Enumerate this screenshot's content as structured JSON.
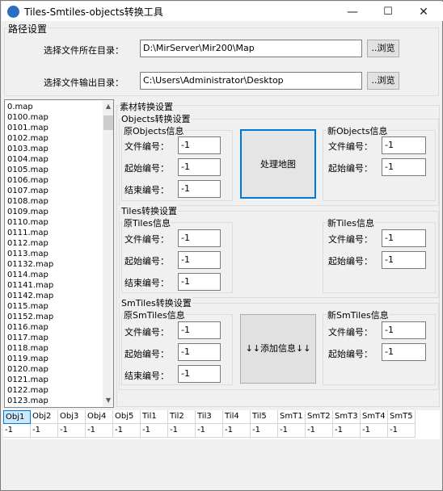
{
  "window": {
    "title": "Tiles-Smtiles-objects转换工具",
    "minimize": "—",
    "maximize": "☐",
    "close": "✕"
  },
  "path_settings": {
    "group_title": "路径设置",
    "input_dir_label": "选择文件所在目录：",
    "input_dir_value": "D:\\MirServer\\Mir200\\Map",
    "output_dir_label": "选择文件输出目录：",
    "output_dir_value": "C:\\Users\\Administrator\\Desktop",
    "browse_label": "..浏览"
  },
  "file_list": [
    "0.map",
    "0100.map",
    "0101.map",
    "0102.map",
    "0103.map",
    "0104.map",
    "0105.map",
    "0106.map",
    "0107.map",
    "0108.map",
    "0109.map",
    "0110.map",
    "0111.map",
    "0112.map",
    "0113.map",
    "01132.map",
    "0114.map",
    "01141.map",
    "01142.map",
    "0115.map",
    "01152.map",
    "0116.map",
    "0117.map",
    "0118.map",
    "0119.map",
    "0120.map",
    "0121.map",
    "0122.map",
    "0123.map"
  ],
  "material": {
    "group_title": "素材转换设置",
    "objects": {
      "group_title": "Objects转换设置",
      "orig_title": "原Objects信息",
      "new_title": "新Objects信息",
      "file_no_label": "文件编号：",
      "start_no_label": "起始编号：",
      "end_no_label": "结束编号：",
      "orig_file_no": "-1",
      "orig_start_no": "-1",
      "orig_end_no": "-1",
      "new_file_no": "-1",
      "new_start_no": "-1",
      "process_button": "处理地图"
    },
    "tiles": {
      "group_title": "Tiles转换设置",
      "orig_title": "原Tiles信息",
      "new_title": "新Tiles信息",
      "file_no_label": "文件编号：",
      "start_no_label": "起始编号：",
      "end_no_label": "结束编号：",
      "orig_file_no": "-1",
      "orig_start_no": "-1",
      "orig_end_no": "-1",
      "new_file_no": "-1",
      "new_start_no": "-1"
    },
    "smtiles": {
      "group_title": "SmTiles转换设置",
      "orig_title": "原SmTiles信息",
      "new_title": "新SmTiles信息",
      "file_no_label": "文件编号：",
      "start_no_label": "起始编号：",
      "end_no_label": "结束编号：",
      "orig_file_no": "-1",
      "orig_start_no": "-1",
      "orig_end_no": "-1",
      "new_file_no": "-1",
      "new_start_no": "-1",
      "add_button": "↓↓添加信息↓↓"
    }
  },
  "grid": {
    "headers": [
      "Obj1",
      "Obj2",
      "Obj3",
      "Obj4",
      "Obj5",
      "Til1",
      "Til2",
      "Til3",
      "Til4",
      "Til5",
      "SmT1",
      "SmT2",
      "SmT3",
      "SmT4",
      "SmT5"
    ],
    "values": [
      "-1",
      "-1",
      "-1",
      "-1",
      "-1",
      "-1",
      "-1",
      "-1",
      "-1",
      "-1",
      "-1",
      "-1",
      "-1",
      "-1",
      "-1"
    ]
  },
  "colors": {
    "accent": "#0078d7",
    "selected_header": "#cce8ff"
  }
}
